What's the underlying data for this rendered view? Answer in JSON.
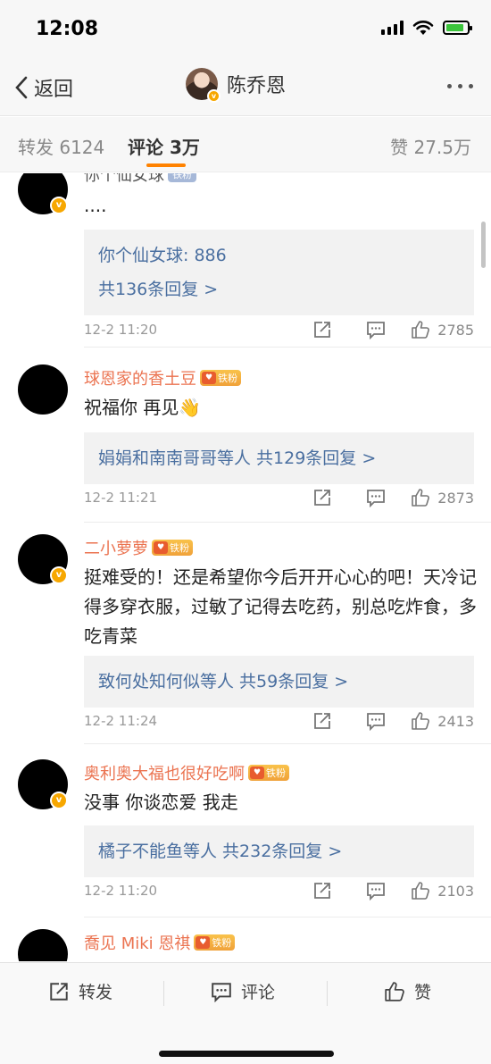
{
  "status_bar": {
    "time": "12:08"
  },
  "nav": {
    "back_label": "返回",
    "title": "陈乔恩"
  },
  "tabs": {
    "repost": "转发 6124",
    "comments": "评论 3万",
    "likes": "赞 27.5万"
  },
  "colors": {
    "accent": "#ff8200",
    "username": "#eb7350",
    "link": "#4a6fa0"
  },
  "comments": [
    {
      "name": "你个仙女球",
      "badge": "铁粉",
      "text": "....",
      "replies": [
        "你个仙女球: 886",
        "共136条回复 >"
      ],
      "time": "12-2 11:20",
      "likes": "2785"
    },
    {
      "name": "球恩家的香土豆",
      "badge": "铁粉",
      "text": "祝福你 再见👋",
      "replies": [
        "娟娟和南南哥哥等人  共129条回复 >"
      ],
      "time": "12-2 11:21",
      "likes": "2873"
    },
    {
      "name": "二小萝萝",
      "badge": "铁粉",
      "text": "挺难受的！还是希望你今后开开心心的吧！天冷记得多穿衣服，过敏了记得去吃药，别总吃炸食，多吃青菜",
      "replies": [
        "致何处知何似等人  共59条回复 >"
      ],
      "time": "12-2 11:24",
      "likes": "2413"
    },
    {
      "name": "奥利奥大福也很好吃啊",
      "badge": "铁粉",
      "text": "没事 你谈恋爱 我走",
      "replies": [
        "橘子不能鱼等人  共232条回复 >"
      ],
      "time": "12-2 11:20",
      "likes": "2103"
    },
    {
      "name": "喬见 Miki 恩祺",
      "badge": "铁粉"
    }
  ],
  "bottom_bar": {
    "repost": "转发",
    "comment": "评论",
    "like": "赞"
  }
}
